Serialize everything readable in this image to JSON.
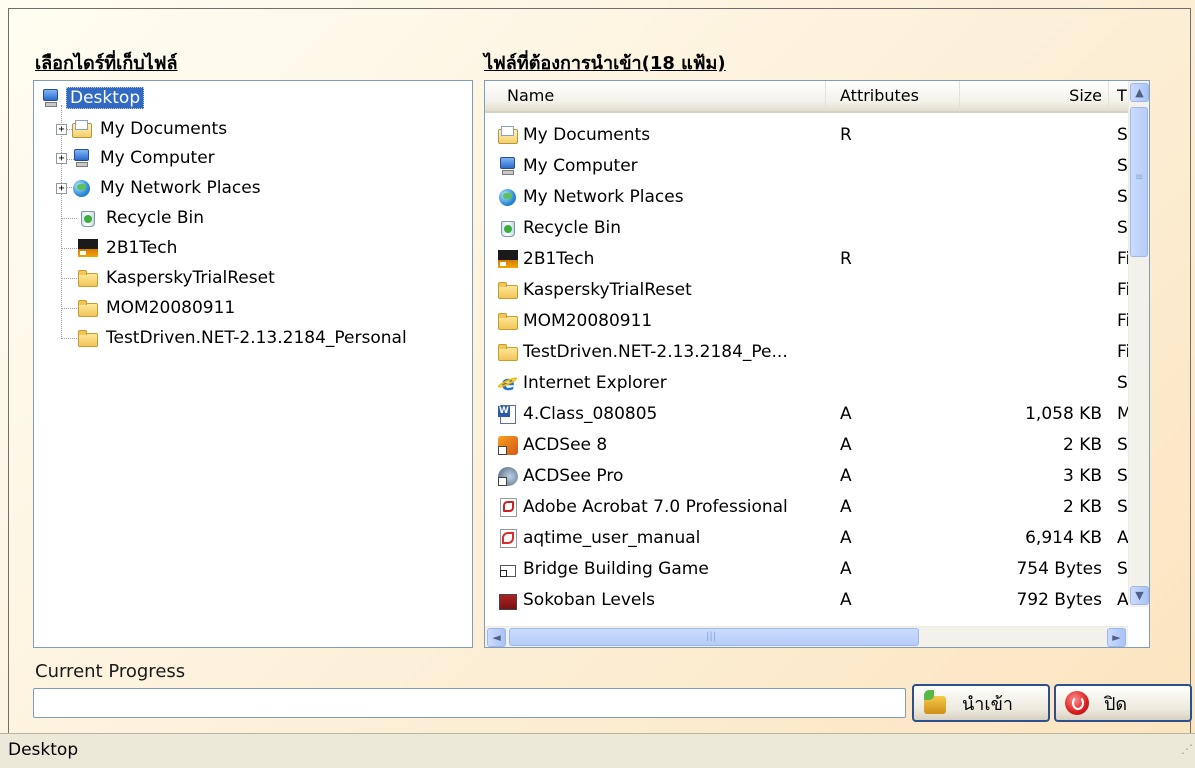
{
  "headings": {
    "folder_tree": "เลือกไดร์ที่เก็บไฟล์",
    "file_list": "ไฟล์ที่ต้องการนำเข้า(18 แฟ้ม)"
  },
  "tree": {
    "items": [
      {
        "label": "Desktop",
        "icon": "desktop-icon",
        "selected": true
      },
      {
        "label": "My Documents",
        "icon": "my-documents-icon",
        "expandable": true
      },
      {
        "label": "My Computer",
        "icon": "computer-icon",
        "expandable": true
      },
      {
        "label": "My Network Places",
        "icon": "network-places-icon",
        "expandable": true
      },
      {
        "label": "Recycle Bin",
        "icon": "recycle-bin-icon"
      },
      {
        "label": "2B1Tech",
        "icon": "2b1tech-icon"
      },
      {
        "label": "KasperskyTrialReset",
        "icon": "folder-icon"
      },
      {
        "label": "MOM20080911",
        "icon": "folder-icon"
      },
      {
        "label": "TestDriven.NET-2.13.2184_Personal",
        "icon": "folder-icon"
      }
    ],
    "expander_glyph": "+"
  },
  "list": {
    "columns": {
      "name": "Name",
      "attributes": "Attributes",
      "size": "Size",
      "type": "T"
    },
    "rows": [
      {
        "name": "My Documents",
        "attr": "R",
        "size": "",
        "type": "Sy"
      },
      {
        "name": "My Computer",
        "attr": "",
        "size": "",
        "type": "Sy"
      },
      {
        "name": "My Network Places",
        "attr": "",
        "size": "",
        "type": "Sy"
      },
      {
        "name": "Recycle Bin",
        "attr": "",
        "size": "",
        "type": "Sy"
      },
      {
        "name": "2B1Tech",
        "attr": "R",
        "size": "",
        "type": "Fil"
      },
      {
        "name": "KasperskyTrialReset",
        "attr": "",
        "size": "",
        "type": "Fil"
      },
      {
        "name": "MOM20080911",
        "attr": "",
        "size": "",
        "type": "Fil"
      },
      {
        "name": "TestDriven.NET-2.13.2184_Pe...",
        "attr": "",
        "size": "",
        "type": "Fil"
      },
      {
        "name": "Internet Explorer",
        "attr": "",
        "size": "",
        "type": "Sy"
      },
      {
        "name": "4.Class_080805",
        "attr": "A",
        "size": "1,058 KB",
        "type": "M"
      },
      {
        "name": "ACDSee 8",
        "attr": "A",
        "size": "2 KB",
        "type": "Sh"
      },
      {
        "name": "ACDSee Pro",
        "attr": "A",
        "size": "3 KB",
        "type": "Sh"
      },
      {
        "name": "Adobe Acrobat 7.0 Professional",
        "attr": "A",
        "size": "2 KB",
        "type": "Sh"
      },
      {
        "name": "aqtime_user_manual",
        "attr": "A",
        "size": "6,914 KB",
        "type": "Ac"
      },
      {
        "name": "Bridge Building Game",
        "attr": "A",
        "size": "754 Bytes",
        "type": "Sh"
      },
      {
        "name": "Sokoban Levels",
        "attr": "A",
        "size": "792 Bytes",
        "type": "Ac"
      }
    ],
    "scroll_glyphs": {
      "up": "▲",
      "down": "▼",
      "left": "◄",
      "right": "►",
      "grip": "≡",
      "hgrip": "|||"
    }
  },
  "progress": {
    "label": "Current Progress",
    "value": 0
  },
  "buttons": {
    "import_label": "นำเข้า",
    "close_label": "ปิด"
  },
  "statusbar": {
    "text": "Desktop",
    "grip": "⋰"
  },
  "colors": {
    "selection": "#316ac5",
    "button_border": "#2d4f8c"
  }
}
